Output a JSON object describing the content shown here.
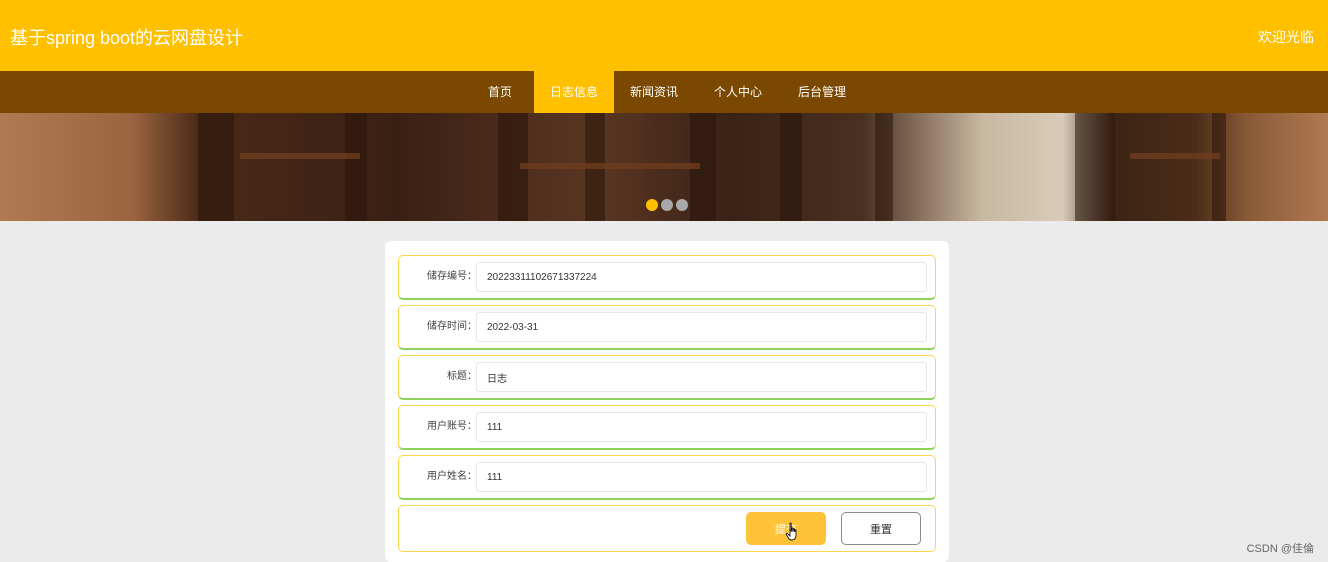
{
  "header": {
    "site_title": "基于spring boot的云网盘设计",
    "welcome": "欢迎光临"
  },
  "nav": {
    "items": [
      {
        "label": "首页"
      },
      {
        "label": "日志信息"
      },
      {
        "label": "新闻资讯"
      },
      {
        "label": "个人中心"
      },
      {
        "label": "后台管理"
      }
    ],
    "active": "日志信息"
  },
  "banner": {
    "slide_count": 3,
    "active_slide": 1
  },
  "form": {
    "fields": [
      {
        "label": "储存编号：",
        "value": "20223311102671337224"
      },
      {
        "label": "储存时间：",
        "value": "2022-03-31"
      },
      {
        "label": "标题：",
        "value": "日志"
      },
      {
        "label": "用户账号：",
        "value": "111"
      },
      {
        "label": "用户姓名：",
        "value": "111"
      }
    ],
    "submit_label": "提交",
    "reset_label": "重置"
  },
  "watermark": "CSDN @佳倫",
  "colors": {
    "header_bg": "#ffc000",
    "nav_bg": "#7a4800",
    "nav_active_bg": "#ffc000",
    "page_bg": "#ebebeb",
    "row_border": "#ffd54a",
    "row_bottom": "#8bd35a",
    "submit_bg": "#ffc33a",
    "dot_active": "#ffc000",
    "dot_inactive": "#a9a9a9"
  }
}
